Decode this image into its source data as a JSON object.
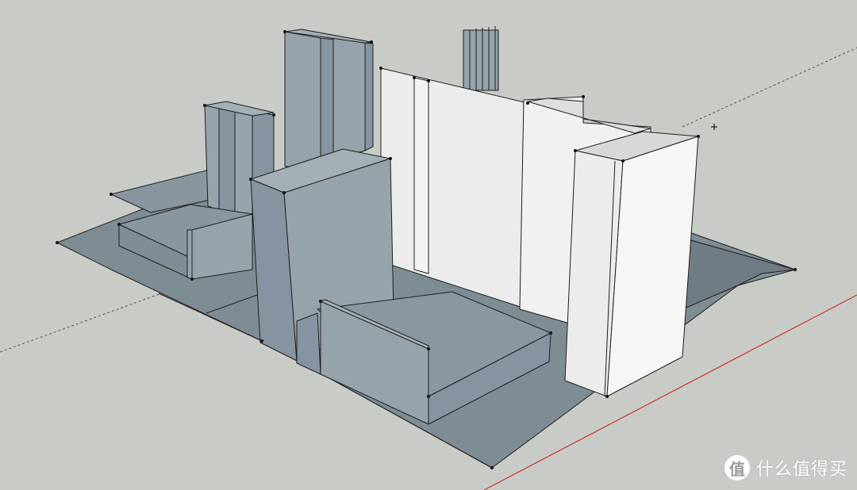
{
  "viewport": {
    "background": "#c9cbc6",
    "model_colors": {
      "ground": "#7e8c94",
      "ground_shadow": "#6f7c83",
      "mass_front": "#96a3ab",
      "mass_side": "#8594a0",
      "mass_top": "#a5b0b6",
      "white_front": "#ececec",
      "white_side": "#f6f6f6",
      "white_top": "#dedede",
      "edge": "#1f1f1f",
      "axis_red": "#cc3333",
      "axis_dash": "#555555"
    }
  },
  "watermark": {
    "icon_glyph": "值",
    "icon_name": "smzdm-logo-icon",
    "text": "什么值得买"
  }
}
